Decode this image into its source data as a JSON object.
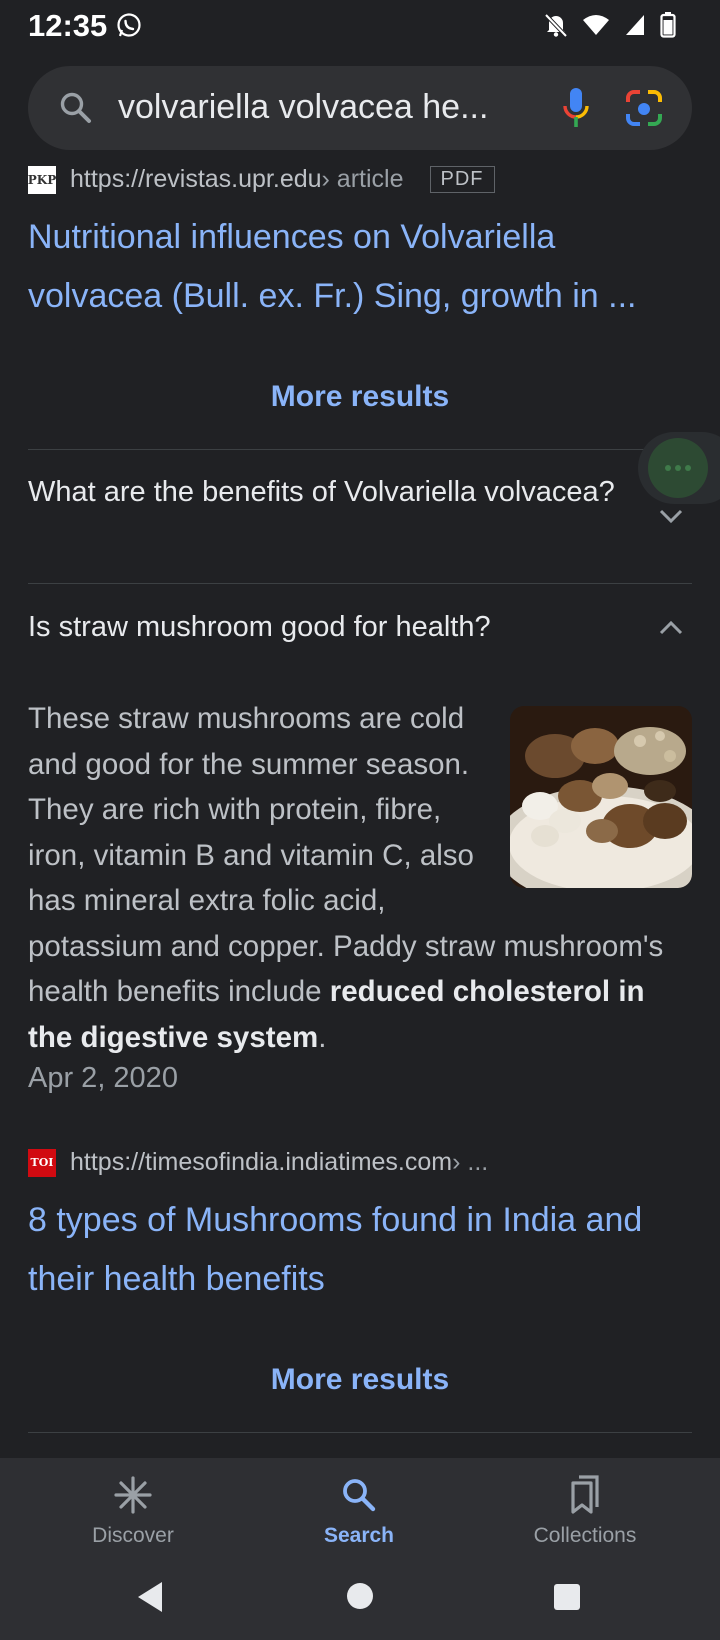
{
  "status_bar": {
    "time": "12:35"
  },
  "search": {
    "query": "volvariella volvacea he..."
  },
  "result1": {
    "favicon_text": "PKP",
    "url": "https://revistas.upr.edu",
    "breadcrumb": " › article",
    "badge": "PDF",
    "title": "Nutritional influences on Volvariella volvacea (Bull. ex. Fr.) Sing, growth in ..."
  },
  "more_results_1": "More results",
  "faq": [
    {
      "question": "What are the benefits of Volvariella volvacea?",
      "expanded": false
    },
    {
      "question": "Is straw mushroom good for health?",
      "expanded": true
    }
  ],
  "answer": {
    "text_before": "These straw mushrooms are cold and good for the summer season. They are rich with protein, fibre, iron, vitamin B and vitamin C, also has mineral extra folic acid, potassium and copper. Paddy straw mushroom's health benefits include ",
    "bold": "reduced cholesterol in the digestive system",
    "text_after": ".",
    "date": "Apr 2, 2020"
  },
  "result2": {
    "favicon_text": "TOI",
    "url": "https://timesofindia.indiatimes.com",
    "breadcrumb": " › ...",
    "title": "8 types of Mushrooms found in India and their health benefits"
  },
  "more_results_2": "More results",
  "bottom_nav": {
    "items": [
      {
        "label": "Discover",
        "icon": "asterisk-icon",
        "active": false
      },
      {
        "label": "Search",
        "icon": "search-icon",
        "active": true
      },
      {
        "label": "Collections",
        "icon": "bookmarks-icon",
        "active": false
      }
    ]
  },
  "colors": {
    "background": "#202124",
    "link": "#8ab4f8",
    "text": "#bdc1c6",
    "nav_bg": "#2e2f33"
  }
}
